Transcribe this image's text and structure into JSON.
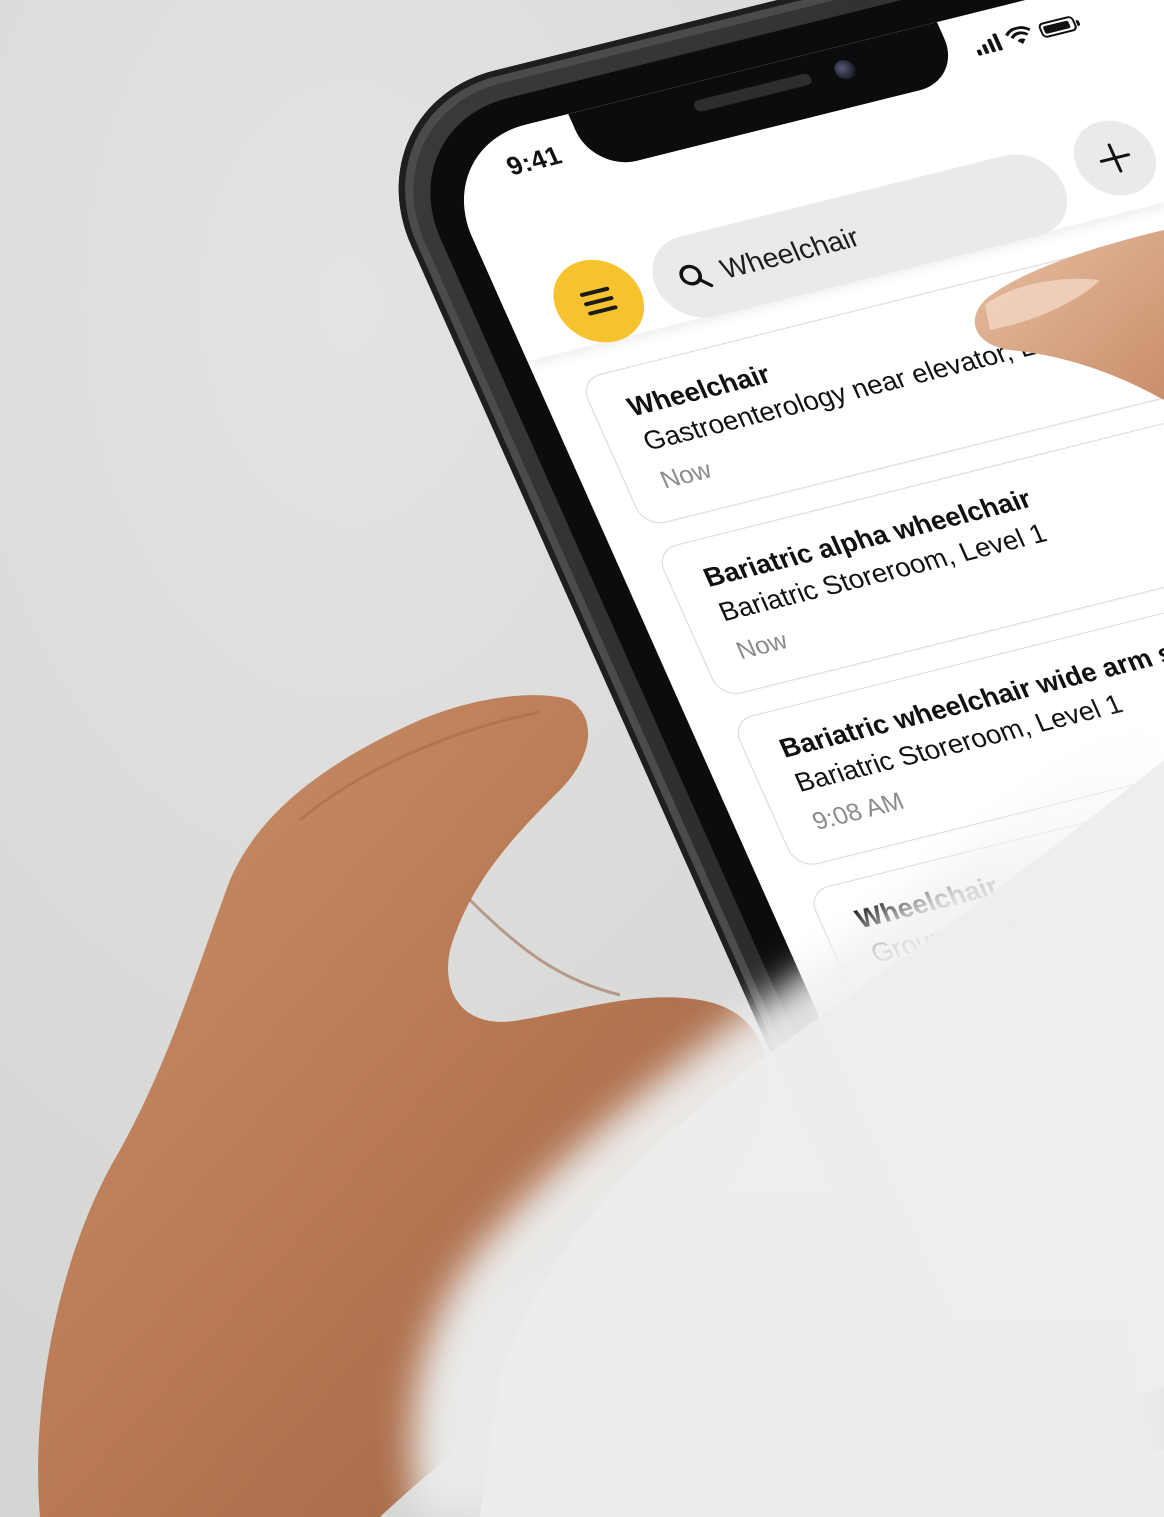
{
  "status_bar": {
    "time": "9:41"
  },
  "header": {
    "menu_icon": "hamburger-icon",
    "search": {
      "icon": "search-icon",
      "value": "Wheelchair"
    },
    "add_icon": "plus-icon",
    "accent_color": "#f6c22d"
  },
  "results": [
    {
      "title": "Wheelchair",
      "location": "Gastroenterology near elevator, Le",
      "time": "Now"
    },
    {
      "title": "Bariatric alpha wheelchair",
      "location": "Bariatric Storeroom, Level 1",
      "time": "Now"
    },
    {
      "title": "Bariatric wheelchair wide arm support",
      "location": "Bariatric Storeroom, Level 1",
      "time": "9:08 AM"
    },
    {
      "title": "Wheelchair",
      "location": "Ground public c",
      "time": ""
    }
  ]
}
